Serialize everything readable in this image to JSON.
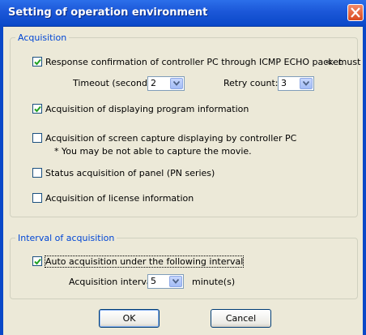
{
  "window": {
    "title": "Setting of operation environment"
  },
  "acquisition": {
    "legend": "Acquisition",
    "icmp": {
      "label": "Response confirmation of controller PC through ICMP ECHO packet",
      "note": "<- must",
      "checked": true
    },
    "timeout": {
      "label": "Timeout (second):",
      "value": "2"
    },
    "retry": {
      "label": "Retry count:",
      "value": "3"
    },
    "program_info": {
      "label": "Acquisition of displaying program information",
      "checked": true
    },
    "screen_capture": {
      "label": "Acquisition of screen capture displaying by controller PC",
      "note": "* You may be not able to capture the movie.",
      "checked": false
    },
    "panel_status": {
      "label": "Status acquisition of panel (PN series)",
      "checked": false
    },
    "license": {
      "label": "Acquisition of license information",
      "checked": false
    }
  },
  "interval": {
    "legend": "Interval of acquisition",
    "auto": {
      "label": "Auto acquisition under the following interval",
      "checked": true
    },
    "acq_interval": {
      "label": "Acquisition interval:",
      "value": "5",
      "unit": "minute(s)"
    }
  },
  "buttons": {
    "ok": "OK",
    "cancel": "Cancel"
  },
  "colors": {
    "title_bar": "#1B57D8",
    "group_legend": "#0046D5",
    "dialog_bg": "#ECE9D8"
  }
}
